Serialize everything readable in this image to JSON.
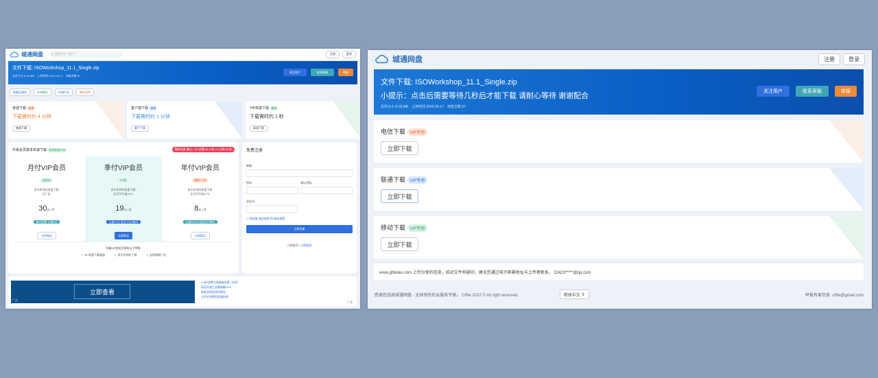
{
  "left": {
    "logo": "城通网盘",
    "search_placeholder": "搜索文件（迅广）",
    "register": "注册",
    "login": "登录",
    "banner": {
      "title": "文件下载: ISOWorkshop_11.1_Single.zip",
      "meta": "文件大小 8.18 MB　上传时间 2022-05-17　浏览次数 67",
      "follow": "关注用户",
      "contact": "联系客服",
      "report": "举报"
    },
    "tabs": [
      "查看压缩包",
      "在线解压",
      "存储打包",
      "转存文件"
    ],
    "downloads": [
      {
        "title": "普通下载",
        "badge": "普通",
        "wait": "下载需时约 4 分钟",
        "btn": "普通下载"
      },
      {
        "title": "客户端下载",
        "badge": "推荐",
        "wait": "下载需时约 1 分钟",
        "btn": "客户下载"
      },
      {
        "title": "VIP高速下载",
        "badge": "推荐",
        "wait": "下载需时约 1 秒",
        "btn": "高速下载"
      }
    ],
    "vip": {
      "heading": "升级会员尊享高速下载",
      "heading_badge": "专享折扣70%",
      "promo": "限时优惠 最后一天! 优惠 00 小时 21 分钟 45 秒",
      "plans": [
        {
          "name": "月付VIP会员",
          "tag": "会员价",
          "desc1": "多文件同时高速下载,",
          "desc2": "无广告,",
          "price": "30",
          "unit": "元 / 月",
          "save": "按月续费 立减5元",
          "buy": "立即购买"
        },
        {
          "name": "季付VIP会员",
          "tag": "8.5折",
          "desc1": "多文件同时高速下载,",
          "desc2": "比月付节省20%,",
          "price": "19",
          "unit": "元 / 月",
          "save": "立减12元 低至19元/每月",
          "buy": "立即购买"
        },
        {
          "name": "年付VIP会员",
          "tag": "最低7.5折",
          "desc1": "多文件同时高速下载,",
          "desc2": "比月付节省27%,",
          "price": "8",
          "unit": "元 / 月",
          "save": "立减264元 低至8元/每月",
          "buy": "立即购买"
        }
      ],
      "perks_title": "升级VIP会员后享有以下特权:",
      "perks": [
        "VIP高速下载通道",
        "多文件同时下载",
        "去除弹窗广告"
      ]
    },
    "register_form": {
      "title": "免费注册",
      "email": "邮箱",
      "password": "密码",
      "confirm": "确认密码",
      "captcha": "验证码",
      "agree": "我同意 服务条款 和 隐私政策",
      "submit": "立即注册",
      "have_account": "已有账号?",
      "login_link": "立即登录"
    },
    "ad": {
      "button": "立即查看",
      "corner": "广告",
      "links": [
        "9.9折话费与网络服务第一时间",
        "英语分类汇总最高额20%",
        "新版全网优质资源站",
        "大学生免费信息服务网"
      ],
      "label": "广告"
    }
  },
  "right": {
    "logo": "城通网盘",
    "register": "注册",
    "login": "登录",
    "banner": {
      "title": "文件下载: ISOWorkshop_11.1_Single.zip",
      "tip": "小提示：点击后需要等待几秒后才能下载 请耐心等待 谢谢配合",
      "meta": "文件大小 8.18 MB　上传时间 2022-05-17　浏览次数 67",
      "follow": "关注用户",
      "contact": "联系客服",
      "report": "举报"
    },
    "downloads": [
      {
        "title": "电信下载",
        "badge": "VIP专用",
        "btn": "立即下载"
      },
      {
        "title": "联通下载",
        "badge": "VIP专用",
        "btn": "立即下载"
      },
      {
        "title": "移动下载",
        "badge": "VIP专用",
        "btn": "立即下载"
      }
    ],
    "notice": "www.ghboke.com 上传分享的信息，如对文件有疑问，建议您通过电子邮箱地址与上传者联系。 22423*****@qq.com",
    "footer": {
      "left": "感谢您选择城通网盘 - 全球领先的云服务专家。 Ctfile 2022 © All right reserved.",
      "lang": "简体中文",
      "right": "举报有害信息: ctfile@gmail.com"
    }
  }
}
